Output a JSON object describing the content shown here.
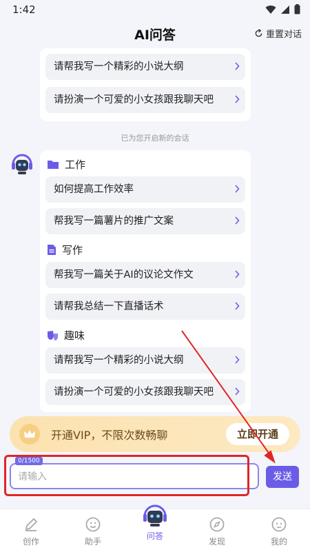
{
  "status": {
    "time": "1:42"
  },
  "header": {
    "title": "AI问答",
    "reset_label": "重置对话"
  },
  "prev_suggestions": [
    "请帮我写一个精彩的小说大纲",
    "请扮演一个可爱的小女孩跟我聊天吧"
  ],
  "notice": "已为您开启新的会话",
  "categories": [
    {
      "name": "工作",
      "icon": "folder-icon",
      "items": [
        "如何提高工作效率",
        "帮我写一篇薯片的推广文案"
      ]
    },
    {
      "name": "写作",
      "icon": "document-icon",
      "items": [
        "帮我写一篇关于AI的议论文作文",
        "请帮我总结一下直播话术"
      ]
    },
    {
      "name": "趣味",
      "icon": "mask-icon",
      "items": [
        "请帮我写一个精彩的小说大纲",
        "请扮演一个可爱的小女孩跟我聊天吧"
      ]
    }
  ],
  "vip": {
    "text": "开通VIP，不限次数畅聊",
    "button": "立即开通"
  },
  "input": {
    "placeholder": "请输入",
    "char_count": "0/1500"
  },
  "send_label": "发送",
  "tabs": [
    {
      "label": "创作",
      "icon": "pen-icon"
    },
    {
      "label": "助手",
      "icon": "smile-icon"
    },
    {
      "label": "问答",
      "icon": "robot-icon",
      "active": true
    },
    {
      "label": "发现",
      "icon": "compass-icon"
    },
    {
      "label": "我的",
      "icon": "profile-icon"
    }
  ],
  "colors": {
    "accent": "#6b5ce7",
    "background": "#f4f5fa",
    "highlight": "#e02525",
    "vip": "#fbe2b0"
  }
}
